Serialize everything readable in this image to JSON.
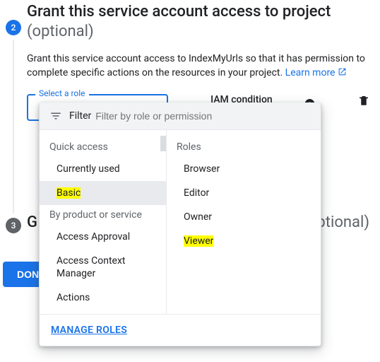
{
  "step2": {
    "number": "2",
    "title": "Grant this service account access to project",
    "optional": "(optional)",
    "desc_prefix": "Grant this service account access to IndexMyUrls so that it has permission to complete specific actions on the resources in your project. ",
    "learn_more": "Learn more",
    "select_role_label": "Select a role",
    "iam_label": "IAM condition (optional)"
  },
  "step3": {
    "number": "3",
    "title_visible": "G",
    "optional_visible": "ptional)"
  },
  "done_label": "DONE",
  "role_picker": {
    "filter_label": "Filter",
    "filter_placeholder": "Filter by role or permission",
    "left": {
      "quick_access_header": "Quick access",
      "quick_access_items": [
        "Currently used",
        "Basic"
      ],
      "by_product_header": "By product or service",
      "by_product_items": [
        "Access Approval",
        "Access Context Manager",
        "Actions"
      ]
    },
    "right": {
      "header": "Roles",
      "items": [
        "Browser",
        "Editor",
        "Owner",
        "Viewer"
      ]
    },
    "manage_label": "MANAGE ROLES"
  },
  "highlighted": {
    "left_index": 1,
    "right_index": 3
  }
}
